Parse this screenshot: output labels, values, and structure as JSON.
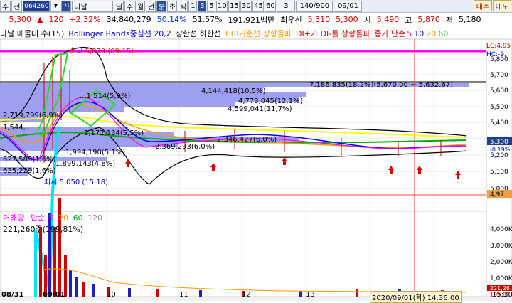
{
  "toolbar": {
    "prefix_1": "주",
    "prefix_2": "전",
    "stock_code": "064260",
    "stock_name": "다날",
    "period_day": "일",
    "period_week": "주",
    "period_month": "월",
    "period_year": "년",
    "period_minute": "분",
    "period_second": "초",
    "period_tick": "틱",
    "interval_1": "1",
    "interval_3": "3",
    "interval_5": "5",
    "interval_10": "10",
    "interval_15": "15",
    "interval_30": "30",
    "interval_45": "45",
    "interval_60": "60",
    "count_3": "3",
    "bars_range": "140/900",
    "date": "09/01",
    "order_buy": "매수",
    "order_sell": "매도"
  },
  "quote": {
    "price": "5,300",
    "change": "120",
    "change_pct": "+2.32%",
    "volume": "34,840,279",
    "ratio1": "50.14%",
    "ratio2": "51.57%",
    "amount": "191,921백만",
    "best_ask_label": "최우선",
    "best_ask": "5,310",
    "best_bid": "5,300",
    "open_label": "시",
    "open": "5,490",
    "high_label": "고",
    "high": "5,870",
    "low_label": "저",
    "low": "5,180"
  },
  "legend": {
    "stock": "다날 매물대 수(15)",
    "bollinger": "Bollinger Bands중심선 20,2",
    "upper_lower": "상한선 하한선",
    "cci": "CCI기준선 상향돌파",
    "di": "DI+가 DI-를 상향돌파",
    "ma_label": "종가 단순",
    "ma5": "5",
    "ma10": "10",
    "ma20": "20",
    "ma60": "60",
    "right_lc": "LC:4,95",
    "right_hc": "HC:-9,"
  },
  "price_axis": [
    "5,800",
    "5,700",
    "5,600",
    "5,500",
    "5,400",
    "5,300",
    "5,200",
    "5,100",
    "5,000"
  ],
  "price_axis_current": "5,300",
  "price_axis_pct": "-0.19%",
  "price_axis_low": "4,97",
  "volume_axis": [
    "4,000K",
    "3,000K",
    "2,000K",
    "1,000K"
  ],
  "volume_axis_current": "221,26",
  "volume_axis_low": "199,81",
  "annotations": {
    "high_mark": "최고 5,870 (09:15)",
    "low_mark": "최저 5,050 (15:18)",
    "range_box": "7,186,835(18,2%)(5,670,00 ~ 5,632,67)",
    "vp1": "4,144,418(10,5%)",
    "vp2": "4,773,045(12,1%)",
    "vp3": "4,599,041(11,7%)",
    "vp4": "2,172,134(5,5%)",
    "vp5": "1,994,190(5,1%)",
    "vp6": "1,899,143(4,8%)",
    "vp7": "625,229(1,6%)",
    "vp8": "627,589(1,6%)",
    "vp9": "2,719,799(6,9%)",
    "vp10": "1,544,...",
    "vp11": "...1,514(5,9%)",
    "vp12": "2,369,293(6,0%)",
    "vp13": "2,346,427(6,0%)"
  },
  "volume_legend": {
    "label": "거래량",
    "ma_label": "단순",
    "ma5": "5",
    "ma20": "20",
    "ma60": "60",
    "ma120": "120",
    "value": "221,260주(199,81%)"
  },
  "x_axis": [
    "08/31",
    "09/01",
    "10",
    "11",
    "12",
    "13"
  ],
  "cursor_time": "2020/09/01(화) 14:36:00",
  "bottom_right_time": "15:30",
  "colors": {
    "volume_profile": "#8f8ff0",
    "ma5": "#ff00ff",
    "ma10": "#0000ff",
    "ma20": "#ff9900",
    "ma60": "#00aa00",
    "highlight_cyan": "#00e5ff",
    "highlight_green": "#22dd22"
  }
}
